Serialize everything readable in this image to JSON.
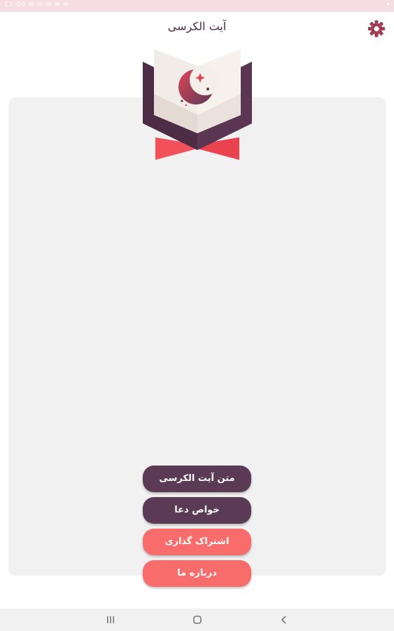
{
  "status_bar": {
    "left_text": "12:00 ✉ ✉ ✉ ✉ ✉",
    "right_text": "▾"
  },
  "header": {
    "title": "آیت الکرسی",
    "settings_icon": "gear-icon"
  },
  "logo": {
    "icon": "quran-book-crescent-icon"
  },
  "menu": {
    "buttons": [
      {
        "label": "متن آیت الکرسی",
        "style": "dark"
      },
      {
        "label": "خواص دعا",
        "style": "dark"
      },
      {
        "label": "اشتراک گذاری",
        "style": "coral"
      },
      {
        "label": "درباره ما",
        "style": "coral"
      }
    ]
  },
  "colors": {
    "primary_dark": "#5b3a55",
    "accent_coral": "#f86c6b",
    "card_background": "#f1f1f2",
    "status_bar": "#f6dde3"
  },
  "navigation": {
    "recents_icon": "recents-icon",
    "home_icon": "home-icon",
    "back_icon": "back-icon"
  }
}
